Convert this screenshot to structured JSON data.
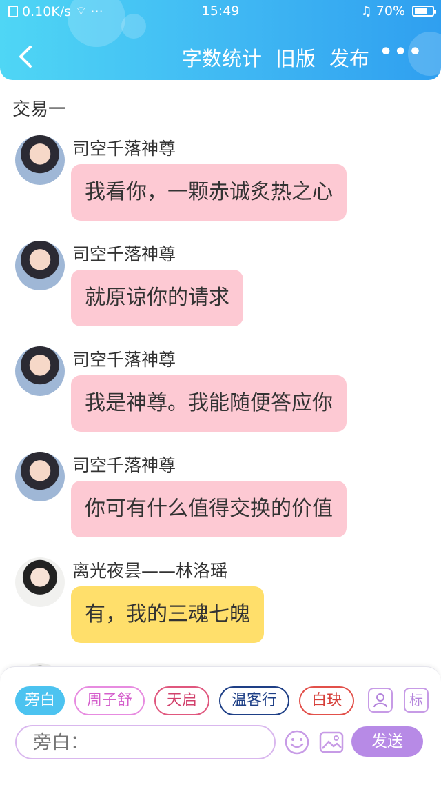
{
  "status_bar": {
    "network_speed": "0.10K/s",
    "time": "15:49",
    "battery": "70%",
    "battery_level": 0.7
  },
  "header": {
    "actions": [
      "字数统计",
      "旧版",
      "发布"
    ],
    "more": "•••"
  },
  "chat": {
    "scene_title": "交易一",
    "messages": [
      {
        "sender": "司空千落神尊",
        "text": "我看你，一颗赤诚炙热之心",
        "style": "pink"
      },
      {
        "sender": "司空千落神尊",
        "text": "就原谅你的请求",
        "style": "pink"
      },
      {
        "sender": "司空千落神尊",
        "text": "我是神尊。我能随便答应你",
        "style": "pink"
      },
      {
        "sender": "司空千落神尊",
        "text": "你可有什么值得交换的价值",
        "style": "pink"
      },
      {
        "sender": "离光夜昙——林洛瑶",
        "text": "有，我的三魂七魄",
        "style": "yellow"
      }
    ]
  },
  "panel": {
    "roles": [
      "旁白",
      "周子舒",
      "天启",
      "温客行",
      "白玦"
    ],
    "active_role": "旁白",
    "input_placeholder": "旁白：",
    "tag_label": "标",
    "send_label": "发送"
  },
  "colors": {
    "header_gradient_start": "#4fd6f5",
    "header_gradient_end": "#2f9ff0",
    "pink_bubble": "#fdc9d3",
    "yellow_bubble": "#ffdf6b",
    "send_button": "#b78ae6",
    "active_chip": "#4cc3f0"
  },
  "icons": [
    "back-icon",
    "wifi-icon",
    "alarm-icon",
    "battery-icon",
    "emoji-icon",
    "image-icon",
    "role-manage-icon"
  ]
}
